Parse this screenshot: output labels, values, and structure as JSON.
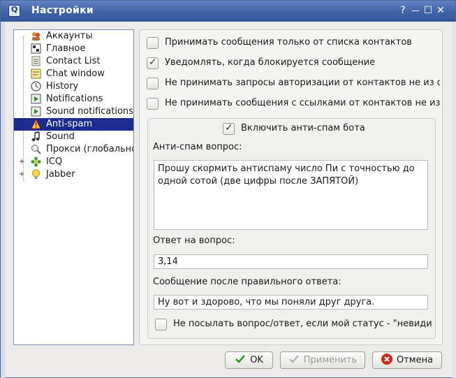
{
  "window": {
    "title": "Настройки",
    "help_glyph": "?",
    "minimize_glyph": "—",
    "maximize_glyph": "☐",
    "close_glyph": "✕"
  },
  "tree": {
    "items": [
      {
        "label": "Аккаунты",
        "icon": "accounts-icon"
      },
      {
        "label": "Главное",
        "icon": "general-icon"
      },
      {
        "label": "Contact List",
        "icon": "contact-list-icon"
      },
      {
        "label": "Chat window",
        "icon": "chat-window-icon"
      },
      {
        "label": "History",
        "icon": "history-icon"
      },
      {
        "label": "Notifications",
        "icon": "notifications-icon"
      },
      {
        "label": "Sound notifications",
        "icon": "sound-notifications-icon"
      },
      {
        "label": "Anti-spam",
        "icon": "warning-icon",
        "selected": true
      },
      {
        "label": "Sound",
        "icon": "sound-icon"
      },
      {
        "label": "Прокси (глобальное)",
        "icon": "proxy-icon"
      },
      {
        "label": "ICQ",
        "icon": "icq-flower-icon",
        "expander": "+"
      },
      {
        "label": "Jabber",
        "icon": "jabber-bulb-icon",
        "expander": "+"
      }
    ]
  },
  "options": {
    "only_contacts": {
      "label": "Принимать сообщения только  от списка контактов",
      "checked": false
    },
    "notify_block": {
      "label": "Уведомлять, когда блокируется сообщение",
      "checked": true
    },
    "no_auth": {
      "label": "Не принимать запросы авторизации от контактов не из списка",
      "checked": false
    },
    "no_links": {
      "label": "Не принимать сообщения с ссылками от контактов не из списка",
      "checked": false
    }
  },
  "bot": {
    "enable_label": "Включить анти-спам бота",
    "enable_checked": true,
    "question_label": "Анти-спам вопрос:",
    "question_value": "Прошу скормить антиспаму число Пи с точностью до одной сотой (две цифры после ЗАПЯТОЙ)",
    "answer_label": "Ответ на вопрос:",
    "answer_value": "3,14",
    "after_label": "Сообщение после правильного ответа:",
    "after_value": "Ну вот и здорово, что мы поняли друг друга.",
    "invisible_label": "Не посылать вопрос/ответ, если мой статус - \"невидимый\"",
    "invisible_checked": false
  },
  "buttons": {
    "ok": "OK",
    "apply": "Применить",
    "cancel": "Отмена"
  },
  "colors": {
    "selection": "#1d2a8f",
    "titlebar": "#3e62a6",
    "ok_check": "#2e9a2e",
    "cancel_red": "#d42a1e"
  }
}
